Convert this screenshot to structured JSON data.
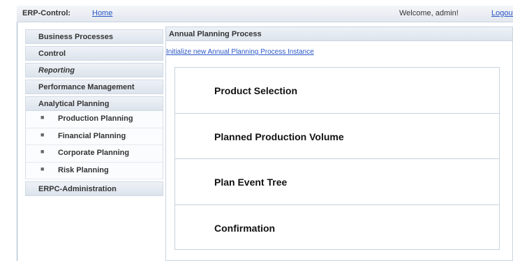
{
  "topbar": {
    "brand": "ERP-Control:",
    "home_link": "Home",
    "welcome": "Welcome, admin!",
    "logout_link": "Logout"
  },
  "sidebar": {
    "items": [
      {
        "label": "Business Processes"
      },
      {
        "label": "Control"
      },
      {
        "label": "Reporting"
      },
      {
        "label": "Performance Management"
      },
      {
        "label": "Analytical Planning"
      }
    ],
    "sub_items": [
      {
        "label": "Production Planning"
      },
      {
        "label": "Financial Planning"
      },
      {
        "label": "Corporate Planning"
      },
      {
        "label": "Risk Planning"
      }
    ],
    "admin": {
      "label": "ERPC-Administration"
    },
    "bullet": "■"
  },
  "panel": {
    "title": "Annual Planning Process",
    "init_link": "Initialize new Annual Planning Process Instance",
    "steps": [
      {
        "label": "Product Selection"
      },
      {
        "label": "Planned Production Volume"
      },
      {
        "label": "Plan Event Tree"
      },
      {
        "label": "Confirmation"
      }
    ]
  }
}
